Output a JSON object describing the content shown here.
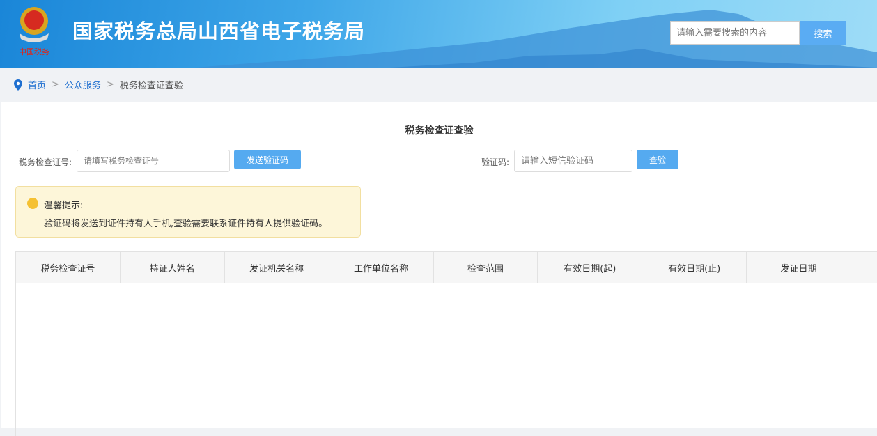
{
  "header": {
    "title": "国家税务总局山西省电子税务局",
    "search_placeholder": "请输入需要搜索的内容",
    "search_button": "搜索",
    "emblem_text": "中国税务"
  },
  "breadcrumb": {
    "items": [
      "首页",
      "公众服务",
      "税务检查证查验"
    ],
    "separator": ">"
  },
  "page": {
    "title": "税务检查证查验",
    "cert_label": "税务检查证号:",
    "cert_placeholder": "请填写税务检查证号",
    "send_button": "发送验证码",
    "code_label": "验证码:",
    "code_placeholder": "请输入短信验证码",
    "verify_button": "查验"
  },
  "tip": {
    "title": "温馨提示:",
    "body": "验证码将发送到证件持有人手机,查验需要联系证件持有人提供验证码。"
  },
  "table": {
    "columns": [
      "税务检查证号",
      "持证人姓名",
      "发证机关名称",
      "工作单位名称",
      "检查范围",
      "有效日期(起)",
      "有效日期(止)",
      "发证日期",
      ""
    ]
  }
}
